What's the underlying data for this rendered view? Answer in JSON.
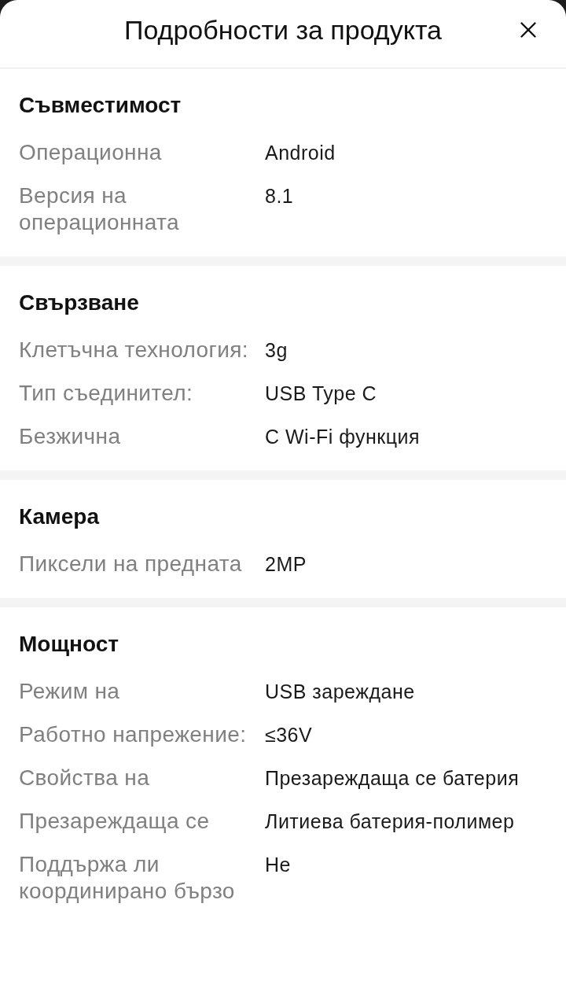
{
  "header": {
    "title": "Подробности за продукта"
  },
  "sections": [
    {
      "title": "Съвместимост",
      "rows": [
        {
          "label": "Операционна",
          "value": "Android"
        },
        {
          "label": "Версия на операционната",
          "value": "8.1"
        }
      ]
    },
    {
      "title": "Свързване",
      "rows": [
        {
          "label": "Клетъчна технология:",
          "value": "3g"
        },
        {
          "label": "Тип съединител:",
          "value": "USB Type C"
        },
        {
          "label": "Безжична",
          "value": "С Wi-Fi функция"
        }
      ]
    },
    {
      "title": "Камера",
      "rows": [
        {
          "label": "Пиксели на предната",
          "value": "2MP"
        }
      ]
    },
    {
      "title": "Мощност",
      "rows": [
        {
          "label": "Режим на",
          "value": "USB зареждане"
        },
        {
          "label": "Работно напрежение:",
          "value": "≤36V"
        },
        {
          "label": "Свойства на",
          "value": "Презареждаща се батерия"
        },
        {
          "label": "Презареждаща се",
          "value": "Литиева батерия-полимер"
        },
        {
          "label": "Поддържа ли координирано бързо",
          "value": "Не"
        }
      ]
    }
  ]
}
